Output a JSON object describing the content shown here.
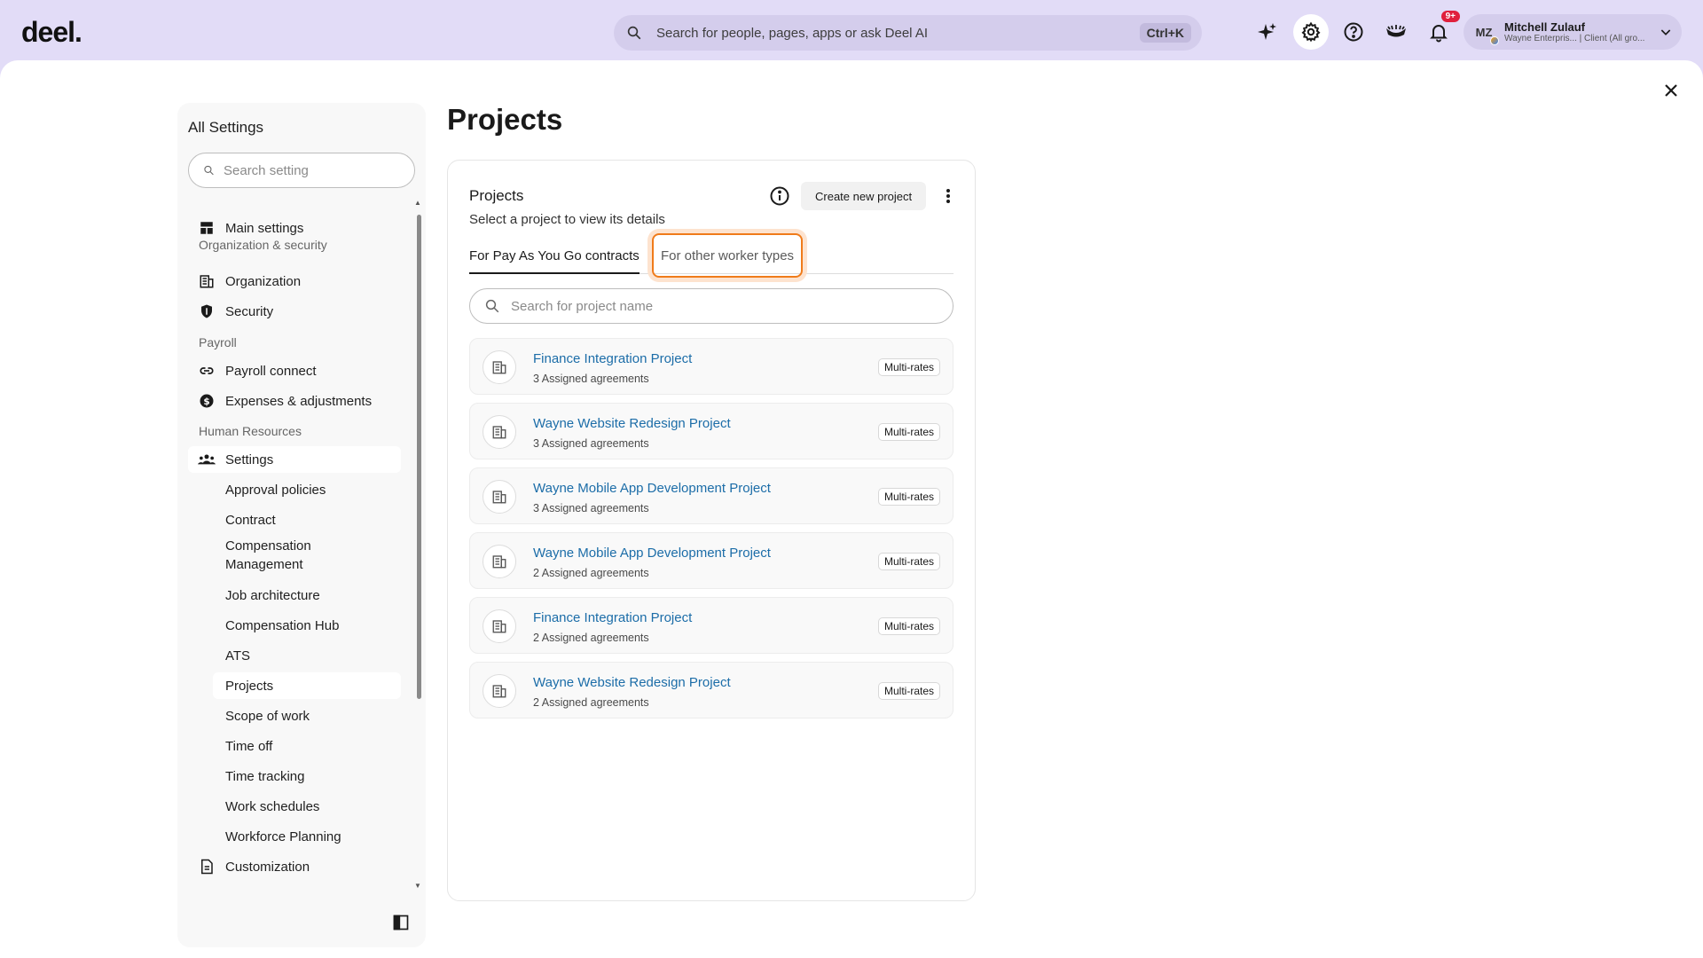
{
  "brand": {
    "logo_text": "deel."
  },
  "header": {
    "search_placeholder": "Search for people, pages, apps or ask Deel AI",
    "shortcut": "Ctrl+K",
    "notifications_badge": "9+",
    "user": {
      "initials": "MZ",
      "name": "Mitchell Zulauf",
      "subtitle": "Wayne Enterpris... | Client (All gro..."
    }
  },
  "sidebar": {
    "title": "All Settings",
    "search_placeholder": "Search setting",
    "main_settings": "Main settings",
    "section_org": "Organization & security",
    "organization": "Organization",
    "security": "Security",
    "section_payroll": "Payroll",
    "payroll_connect": "Payroll connect",
    "expenses": "Expenses & adjustments",
    "section_hr": "Human Resources",
    "settings": "Settings",
    "sub_items": [
      "Approval policies",
      "Contract",
      "Compensation Management",
      "Job architecture",
      "Compensation Hub",
      "ATS",
      "Projects",
      "Scope of work",
      "Time off",
      "Time tracking",
      "Work schedules",
      "Workforce Planning"
    ],
    "customization": "Customization"
  },
  "page": {
    "title": "Projects",
    "card": {
      "title": "Projects",
      "subtitle": "Select a project to view its details",
      "create_button": "Create new project",
      "tabs": [
        "For Pay As You Go contracts",
        "For other worker types"
      ],
      "search_placeholder": "Search for project name",
      "projects": [
        {
          "name": "Finance Integration Project",
          "meta": "3 Assigned agreements",
          "tag": "Multi-rates"
        },
        {
          "name": "Wayne Website Redesign Project",
          "meta": "3 Assigned agreements",
          "tag": "Multi-rates"
        },
        {
          "name": "Wayne Mobile App Development Project",
          "meta": "3 Assigned agreements",
          "tag": "Multi-rates"
        },
        {
          "name": "Wayne Mobile App Development Project",
          "meta": "2 Assigned agreements",
          "tag": "Multi-rates"
        },
        {
          "name": "Finance Integration Project",
          "meta": "2 Assigned agreements",
          "tag": "Multi-rates"
        },
        {
          "name": "Wayne Website Redesign Project",
          "meta": "2 Assigned agreements",
          "tag": "Multi-rates"
        }
      ]
    }
  },
  "colors": {
    "header_bg": "#e2dcf7",
    "link": "#1c6da8",
    "highlight": "#f07b1a",
    "badge": "#e0203d"
  }
}
